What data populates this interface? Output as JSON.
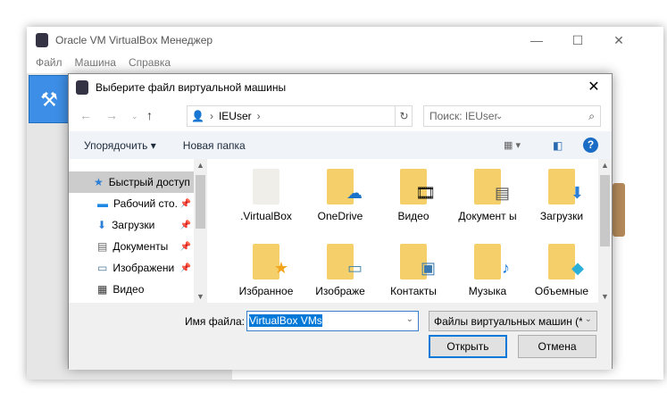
{
  "app": {
    "title": "Oracle VM VirtualBox Менеджер",
    "menu": [
      "Файл",
      "Машина",
      "Справка"
    ]
  },
  "dialog": {
    "title": "Выберите файл виртуальной машины",
    "breadcrumb": "IEUser",
    "search_placeholder": "Поиск: IEUser",
    "toolbar": {
      "organize": "Упорядочить",
      "new_folder": "Новая папка"
    },
    "nav_items": [
      {
        "label": "Быстрый доступ",
        "icon": "star-icon"
      },
      {
        "label": "Рабочий сто.",
        "icon": "desktop-icon",
        "pinned": true
      },
      {
        "label": "Загрузки",
        "icon": "download-icon",
        "pinned": true
      },
      {
        "label": "Документы",
        "icon": "document-icon",
        "pinned": true
      },
      {
        "label": "Изображени",
        "icon": "image-icon",
        "pinned": true
      },
      {
        "label": "Видео",
        "icon": "video-icon"
      }
    ],
    "files": [
      {
        "label": ".VirtualBox",
        "icon": "folder-icon"
      },
      {
        "label": "OneDrive",
        "icon": "onedrive-folder-icon"
      },
      {
        "label": "Видео",
        "icon": "video-folder-icon"
      },
      {
        "label": "Документ ы",
        "icon": "documents-folder-icon"
      },
      {
        "label": "Загрузки",
        "icon": "downloads-folder-icon"
      },
      {
        "label": "Избранное",
        "icon": "favorites-folder-icon"
      },
      {
        "label": "Изображе",
        "icon": "pictures-folder-icon"
      },
      {
        "label": "Контакты",
        "icon": "contacts-folder-icon"
      },
      {
        "label": "Музыка",
        "icon": "music-folder-icon"
      },
      {
        "label": "Объемные",
        "icon": "3d-objects-folder-icon"
      }
    ],
    "filename_label": "Имя файла:",
    "filename_value": "VirtualBox VMs",
    "filetype": "Файлы виртуальных машин (*",
    "open": "Открыть",
    "cancel": "Отмена"
  }
}
